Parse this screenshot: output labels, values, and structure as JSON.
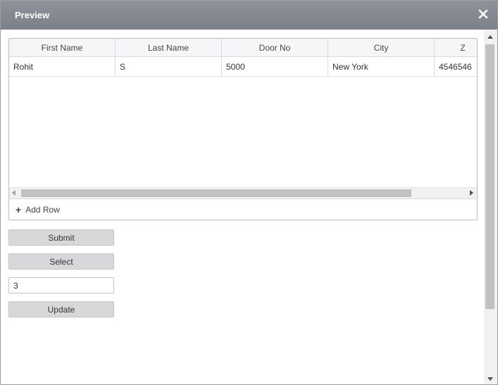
{
  "dialog": {
    "title": "Preview",
    "close_icon": "close-icon"
  },
  "grid": {
    "columns": [
      "First Name",
      "Last Name",
      "Door No",
      "City",
      "Z"
    ],
    "rows": [
      [
        "Rohit",
        "S",
        "5000",
        "New York",
        "4546546"
      ]
    ],
    "add_row_label": "Add Row"
  },
  "form": {
    "submit_label": "Submit",
    "select_label": "Select",
    "number_value": "3",
    "update_label": "Update"
  },
  "colors": {
    "titlebar": "#858991",
    "button": "#d7d8da"
  }
}
